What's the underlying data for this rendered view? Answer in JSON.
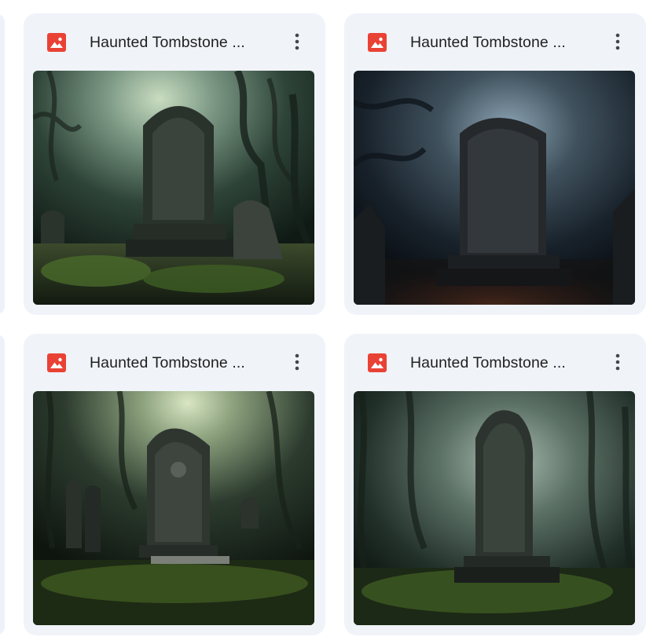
{
  "files": [
    {
      "name": "Haunted Tombstone ...",
      "type_icon": "image-file-icon",
      "menu_icon": "more-vert-icon"
    },
    {
      "name": "Haunted Tombstone ...",
      "type_icon": "image-file-icon",
      "menu_icon": "more-vert-icon"
    },
    {
      "name": "Haunted Tombstone ...",
      "type_icon": "image-file-icon",
      "menu_icon": "more-vert-icon"
    },
    {
      "name": "Haunted Tombstone ...",
      "type_icon": "image-file-icon",
      "menu_icon": "more-vert-icon"
    }
  ],
  "colors": {
    "card_bg": "#f0f3f8",
    "file_icon_red": "#e94235",
    "title_text": "#1f1f1f",
    "menu_icon": "#444746"
  }
}
